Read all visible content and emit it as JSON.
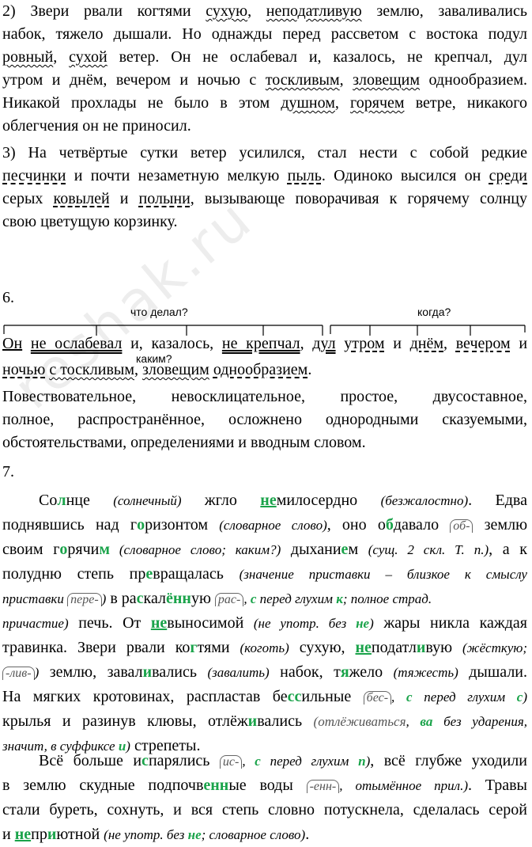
{
  "para2": {
    "num": "2)",
    "l1": [
      " Звери рвали когтями ",
      "сухую",
      ", ",
      "неподатливую",
      " землю, заваливались"
    ],
    "l2": "набок, тяжело дышали. Но однажды перед рассветом с востока подул",
    "l3": [
      "ровный",
      ", ",
      "сухой",
      " ветер. Он не ослабевал и, казалось, не крепчал, дул"
    ],
    "l4": [
      "утром и днём, вечером и ночью с ",
      "тоскливым",
      ", ",
      "зловещим",
      " однообразием."
    ],
    "l5": [
      "Никакой прохлады не было в этом ",
      "душном",
      ", ",
      "горячем",
      " ветре, никакого"
    ],
    "l6": "облегчения он не приносил."
  },
  "para3": {
    "num": "3)",
    "l1": " На четвёртые сутки ветер усилился, стал нести с собой редкие",
    "l2": [
      "песчинки",
      " и почти незаметную мелкую ",
      "пыль",
      ". Одиноко высился он ",
      "среди"
    ],
    "l3": [
      "серых ",
      "ковылей",
      " и ",
      "полыни",
      ", вызывающе поворачивая к горячему солнцу"
    ],
    "l4": "свою цветущую корзинку."
  },
  "section6": {
    "num": "6.",
    "q1": "что делал?",
    "q2": "когда?",
    "q3": "каким?",
    "s1": [
      "Он",
      " ",
      "не ослабевал",
      " и, казалось, ",
      "не крепчал",
      ", ",
      "дул",
      " ",
      "утром",
      " и ",
      "днём",
      ", ",
      "вечером",
      " и"
    ],
    "s2": [
      "ночью",
      " ",
      "с тоскливым",
      ", ",
      "зловещим",
      " ",
      "однообразием",
      "."
    ],
    "desc1": "Повествовательное, невосклицательное, простое, двусоставное,",
    "desc2": "полное, распространённое, осложнено однородными сказуемыми,",
    "desc3": "обстоятельствами, определениями и вводным словом."
  },
  "section7": {
    "num": "7.",
    "t": {
      "a1": "Со",
      "a2": "л",
      "a3": "нце ",
      "a4": "(солнечный)",
      "a5": " жгло ",
      "a6": "не",
      "a7": "милосердно ",
      "a8": "(безжалостно)",
      "a9": ". Едва",
      "b1": "поднявшись над г",
      "b2": "о",
      "b3": "ризонтом ",
      "b4": "(словарное слово)",
      "b5": ", оно о",
      "b6": "б",
      "b7": "давало ",
      "b8": "об-",
      "b9": " землю",
      "c1": "своим г",
      "c2": "о",
      "c3": "рячи",
      "c4": "м",
      "c5": " (словарное слово; каким?)",
      "c6": " дыхани",
      "c7": "е",
      "c8": "м ",
      "c9": "(сущ. 2 скл. Т. п.)",
      "c10": ", а к",
      "d1": "полудню степь пр",
      "d2": "е",
      "d3": "вращалась ",
      "d4": "(значение приставки – близкое к смыслу",
      "e1": "приставки ",
      "e2": "пере-",
      "e3": ")",
      "e4": "    в ра",
      "e5": "с",
      "e6": "кал",
      "e7": "ё",
      "e8": "нн",
      "e9": "ую    ",
      "e10": "рас-",
      "e11": ", ",
      "e12": "с",
      "e13": " перед глухим ",
      "e14": "к",
      "e15": "; полное страд.",
      "f1": "причастие)",
      "f2": " печь. От ",
      "f3": "не",
      "f4": "выносимой ",
      "f5": "(не употр. без ",
      "f6": "не",
      "f7": ")",
      "f8": " жары никла каждая",
      "g1": "травинка. Звери рвали ко",
      "g2": "г",
      "g3": "тями ",
      "g4": "(коготь)",
      "g5": " сухую, ",
      "g6": "не",
      "g7": "податл",
      "g8": "и",
      "g9": "вую ",
      "g10": "(жёсткую;",
      "h1": "-лив-",
      "h2": ")",
      "h3": " землю, завал",
      "h4": "и",
      "h5": "вались ",
      "h6": "(завалить)",
      "h7": " набок, т",
      "h8": "я",
      "h9": "жело ",
      "h10": "(тяжесть)",
      "h11": " дышали.",
      "k1": "На мягких кротовинах, распластав бе",
      "k2": "сс",
      "k3": "ильные   ",
      "k4": "бес-",
      "k5": ", ",
      "k6": "с",
      "k7": " перед глухим ",
      "k8": "с",
      "k9": ")",
      "m1": "крылья и разинув клювы, отлёж",
      "m2": "и",
      "m3": "вались ",
      "m4": "(отлёживаться",
      "m5": ", ",
      "m6": "ва",
      "m7": " без ударения,",
      "n1": "значит, в суффиксе ",
      "n2": "и",
      "n3": ")",
      "n4": " стрепеты.",
      "o1": "Всё больше и",
      "o2": "с",
      "o3": "парялись ",
      "o4": "ис-",
      "o5": ", ",
      "o6": "с",
      "o7": " перед глухим ",
      "o8": "п",
      "o9": ")",
      "o10": ", всё глубже уходили",
      "p1": "в землю скудные подпочв",
      "p2": "енн",
      "p3": "ые воды   ",
      "p4": "-енн-",
      "p5": ", отымённое прил.)",
      "p6": ". Травы",
      "q1": "стали буреть, сохнуть, и вся степь словно потускнела, сделалась серой",
      "r1": "и ",
      "r2": "не",
      "r3": "пр",
      "r4": "и",
      "r5": "ютной ",
      "r6": "(не употр. без ",
      "r7": "не",
      "r8": "; словарное слово)",
      "r9": "."
    }
  },
  "watermark": "reshak.ru"
}
